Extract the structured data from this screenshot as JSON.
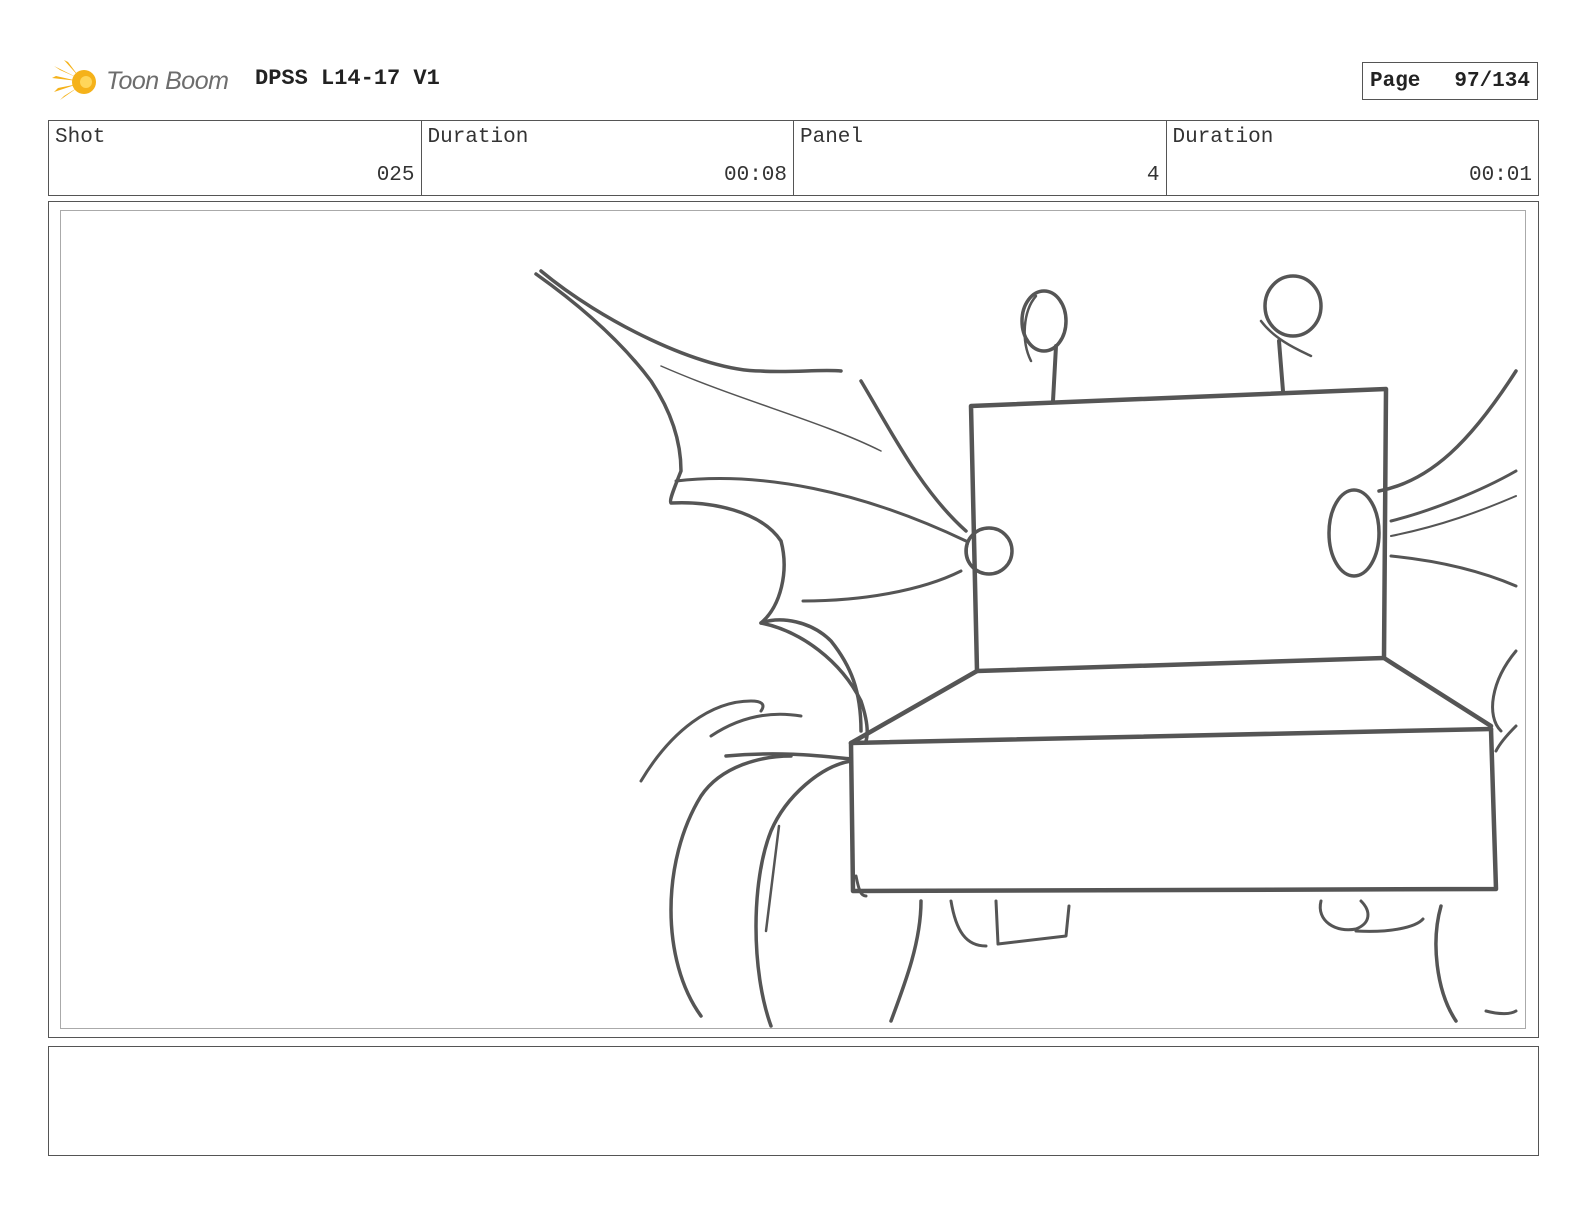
{
  "header": {
    "logo_text": "Toon Boom",
    "project_title": "DPSS L14-17 V1",
    "page_label": "Page",
    "page_number": "97/134"
  },
  "info": {
    "shot_label": "Shot",
    "shot_value": "025",
    "shot_duration_label": "Duration",
    "shot_duration_value": "00:08",
    "panel_label": "Panel",
    "panel_value": "4",
    "panel_duration_label": "Duration",
    "panel_duration_value": "00:01"
  },
  "sketch": {
    "subject": "rough-storyboard-vehicle-with-wings",
    "stroke_color": "#555555",
    "frame_color": "#aaaaaa"
  },
  "colors": {
    "logo_flame": "#f5b21a",
    "text": "#333333",
    "border": "#555555"
  },
  "notes": {
    "text": ""
  }
}
